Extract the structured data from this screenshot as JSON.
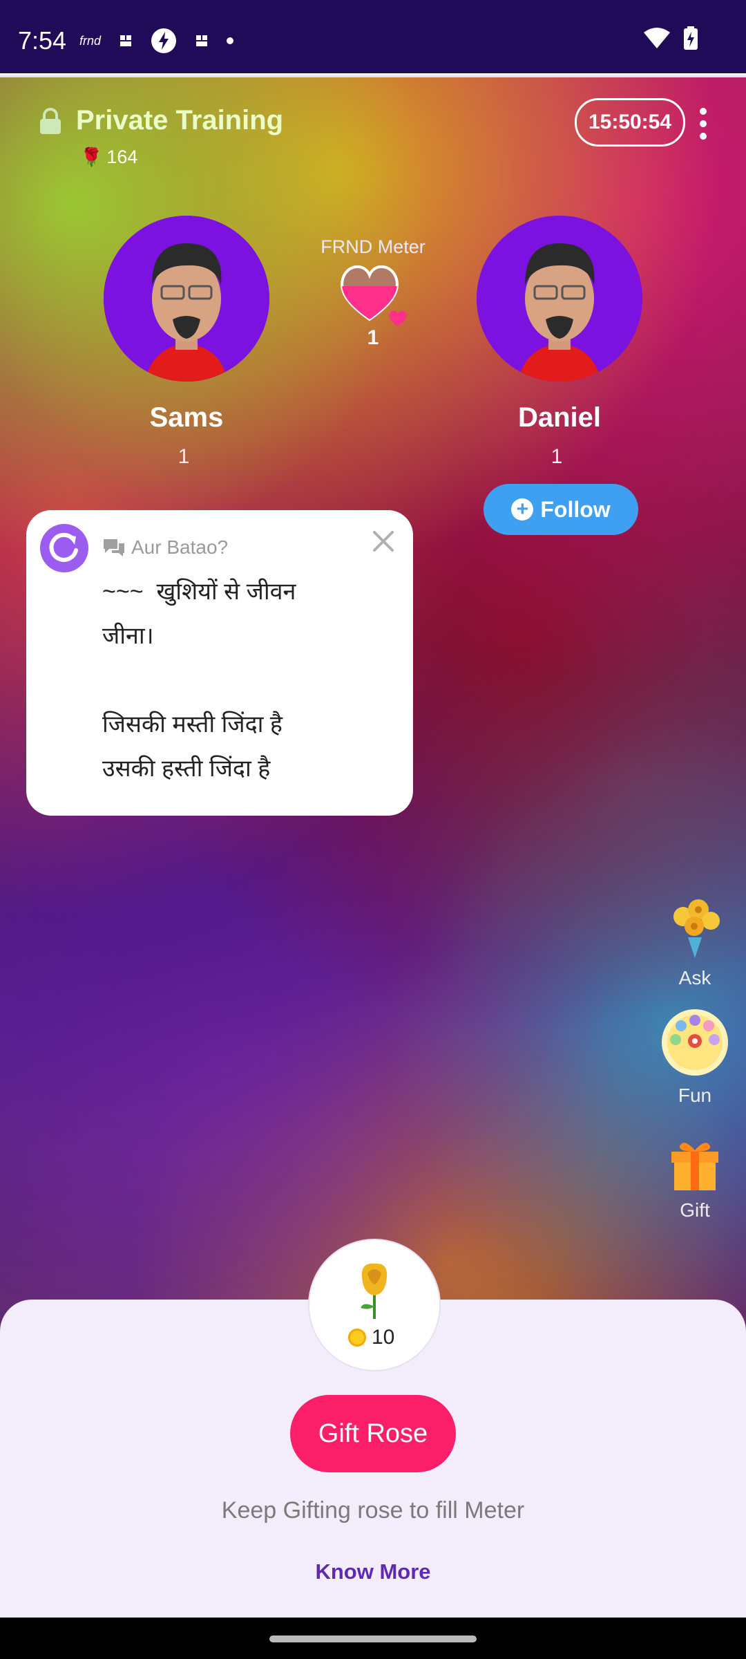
{
  "status_bar": {
    "time": "7:54",
    "app_badge": "frnd",
    "icons": [
      "grid-icon",
      "bolt-icon",
      "grid-icon",
      "dot-icon",
      "wifi-icon",
      "battery-icon"
    ]
  },
  "room": {
    "title": "Private Training",
    "coins": "164",
    "timer": "15:50:54"
  },
  "users": [
    {
      "name": "Sams",
      "count": "1"
    },
    {
      "name": "Daniel",
      "count": "1"
    }
  ],
  "meter": {
    "label": "FRND Meter",
    "count": "1"
  },
  "follow": {
    "label": "Follow"
  },
  "chat": {
    "topic": "Aur Batao?",
    "body": "~~~  खुशियों से जीवन\nजीना।\n\nजिसकी मस्ती जिंदा है\nउसकी हस्ती जिंदा है"
  },
  "side_actions": [
    {
      "label": "Ask",
      "icon": "flower-bouquet-icon"
    },
    {
      "label": "Fun",
      "icon": "game-balls-icon"
    },
    {
      "label": "Gift",
      "icon": "gift-box-icon"
    }
  ],
  "gift_panel": {
    "price": "10",
    "button": "Gift Rose",
    "hint": "Keep Gifting rose to fill Meter",
    "link": "Know More"
  },
  "colors": {
    "accent": "#fb1f6a",
    "follow": "#3fa0f2",
    "link": "#5e2bb0",
    "avatar_bg": "#7c12e0"
  }
}
